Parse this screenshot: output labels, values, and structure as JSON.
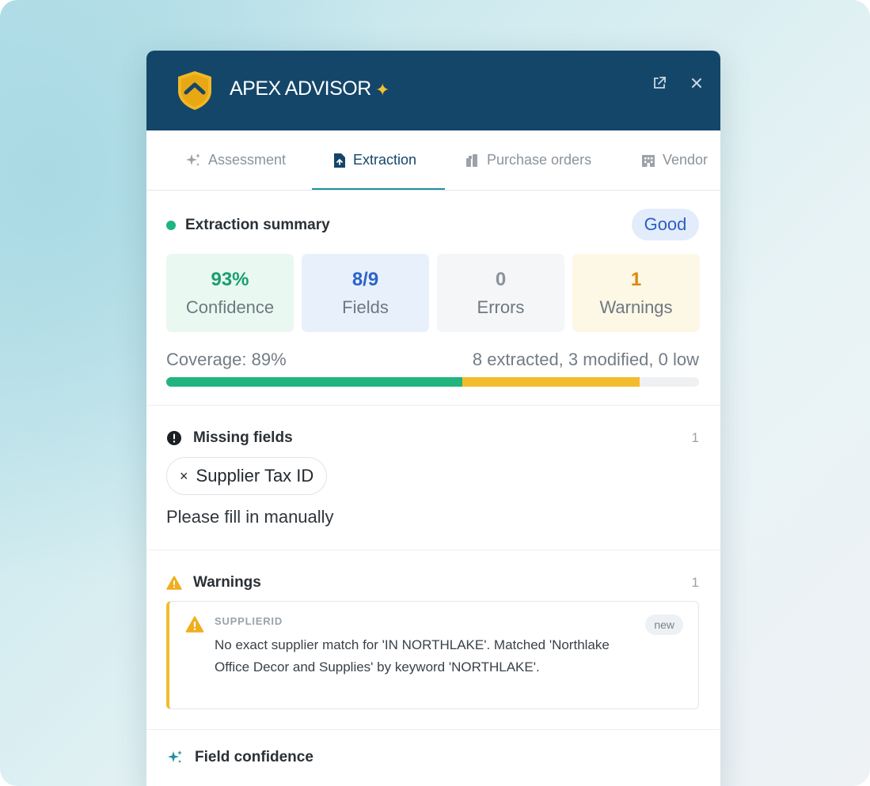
{
  "header": {
    "title": "APEX ADVISOR",
    "sparkle": "✦",
    "popout_icon": "external-link-icon",
    "close_icon": "close-icon"
  },
  "tabs": [
    {
      "label": "Assessment",
      "icon": "sparkles-icon",
      "active": false
    },
    {
      "label": "Extraction",
      "icon": "document-icon",
      "active": true
    },
    {
      "label": "Purchase orders",
      "icon": "boxes-icon",
      "active": false
    },
    {
      "label": "Vendor",
      "icon": "building-icon",
      "active": false
    }
  ],
  "summary": {
    "title": "Extraction summary",
    "status_badge": "Good",
    "stats": [
      {
        "value": "93%",
        "label": "Confidence",
        "color": "#1a9e6e",
        "bg": "#e9f8f1"
      },
      {
        "value": "8/9",
        "label": "Fields",
        "color": "#2c63c9",
        "bg": "#e8f0fc"
      },
      {
        "value": "0",
        "label": "Errors",
        "color": "#8a939c",
        "bg": "#f4f6f8"
      },
      {
        "value": "1",
        "label": "Warnings",
        "color": "#d98a0f",
        "bg": "#fdf7e6"
      }
    ],
    "coverage_label": "Coverage: 89%",
    "coverage_detail": "8 extracted, 3 modified, 0 low",
    "coverage_extracted_fraction": 0.555,
    "coverage_modified_fraction": 0.333
  },
  "missing": {
    "title": "Missing fields",
    "count": "1",
    "chip_x": "×",
    "chip_label": "Supplier Tax ID",
    "note": "Please fill in manually"
  },
  "warnings": {
    "title": "Warnings",
    "count": "1",
    "items": [
      {
        "code": "SUPPLIERID",
        "message": "No exact supplier match for 'IN NORTHLAKE'. Matched 'Northlake Office Decor and Supplies' by keyword 'NORTHLAKE'.",
        "badge": "new"
      }
    ]
  },
  "field_confidence": {
    "title": "Field confidence"
  },
  "colors": {
    "header_bg": "#14466a",
    "accent_teal": "#1f8f9a",
    "bar_green": "#21b47f",
    "bar_yellow": "#f3bc2c"
  }
}
